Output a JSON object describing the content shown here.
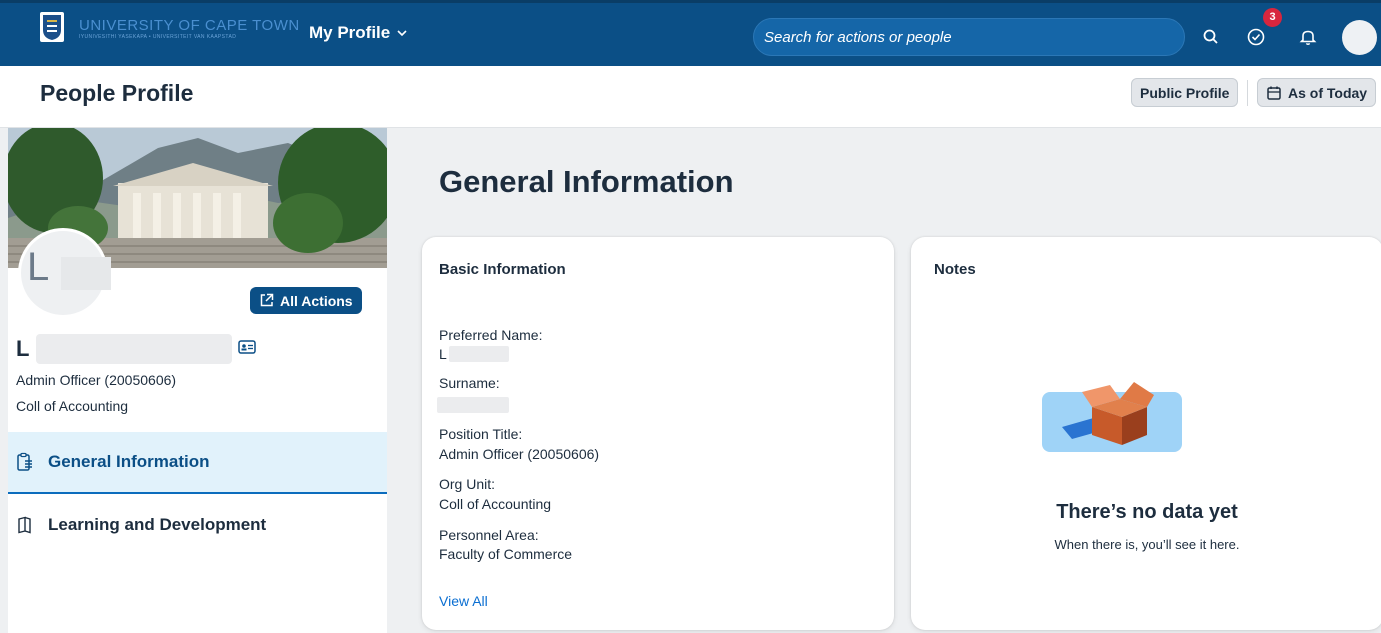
{
  "header": {
    "university_name": "UNIVERSITY OF CAPE TOWN",
    "university_subtitle": "IYUNIVESITHI YASEKAPA • UNIVERSITEIT VAN KAAPSTAD",
    "app_menu_label": "My Profile",
    "search_placeholder": "Search for actions or people",
    "tasks_badge_count": "3"
  },
  "titlebar": {
    "title": "People Profile",
    "public_profile_label": "Public Profile",
    "as_of_label": "As of Today"
  },
  "profile": {
    "avatar_initial": "L",
    "all_actions_label": "All Actions",
    "name_initial": "L",
    "position": "Admin Officer (20050606)",
    "org_unit": "Coll of Accounting"
  },
  "nav": {
    "items": [
      {
        "label": "General Information",
        "active": true
      },
      {
        "label": "Learning and Development",
        "active": false
      }
    ]
  },
  "main": {
    "section_title": "General Information",
    "basic_info": {
      "title": "Basic Information",
      "fields": [
        {
          "label": "Preferred Name:",
          "value": "L"
        },
        {
          "label": "Surname:",
          "value": ""
        },
        {
          "label": "Position Title:",
          "value": "Admin Officer (20050606)"
        },
        {
          "label": "Org Unit:",
          "value": "Coll of Accounting"
        },
        {
          "label": "Personnel Area:",
          "value": "Faculty of Commerce"
        }
      ],
      "view_all_label": "View All"
    },
    "notes": {
      "title": "Notes",
      "empty_title": "There’s no data yet",
      "empty_subtitle": "When there is, you’ll see it here."
    }
  },
  "colors": {
    "header_bg": "#0b4f86",
    "accent": "#0b4f86",
    "link": "#0a6ed1",
    "nav_active_bg": "#e1f2fb",
    "badge": "#d8263e"
  }
}
